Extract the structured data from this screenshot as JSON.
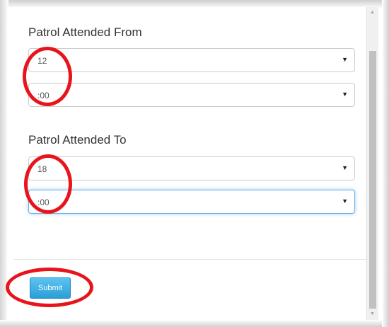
{
  "form": {
    "from_label": "Patrol Attended From",
    "from_hour": "12",
    "from_minute": ":00",
    "to_label": "Patrol Attended To",
    "to_hour": "18",
    "to_minute": ":00",
    "submit_label": "Submit"
  },
  "icons": {
    "dropdown": "caret-down-icon",
    "dropdown_glyph": "▼",
    "scroll_up_glyph": "▲",
    "scroll_down_glyph": "▼"
  },
  "colors": {
    "submit_bg": "#2a9fd6",
    "focus_border": "#66afe9",
    "annotation": "#e8141c"
  }
}
